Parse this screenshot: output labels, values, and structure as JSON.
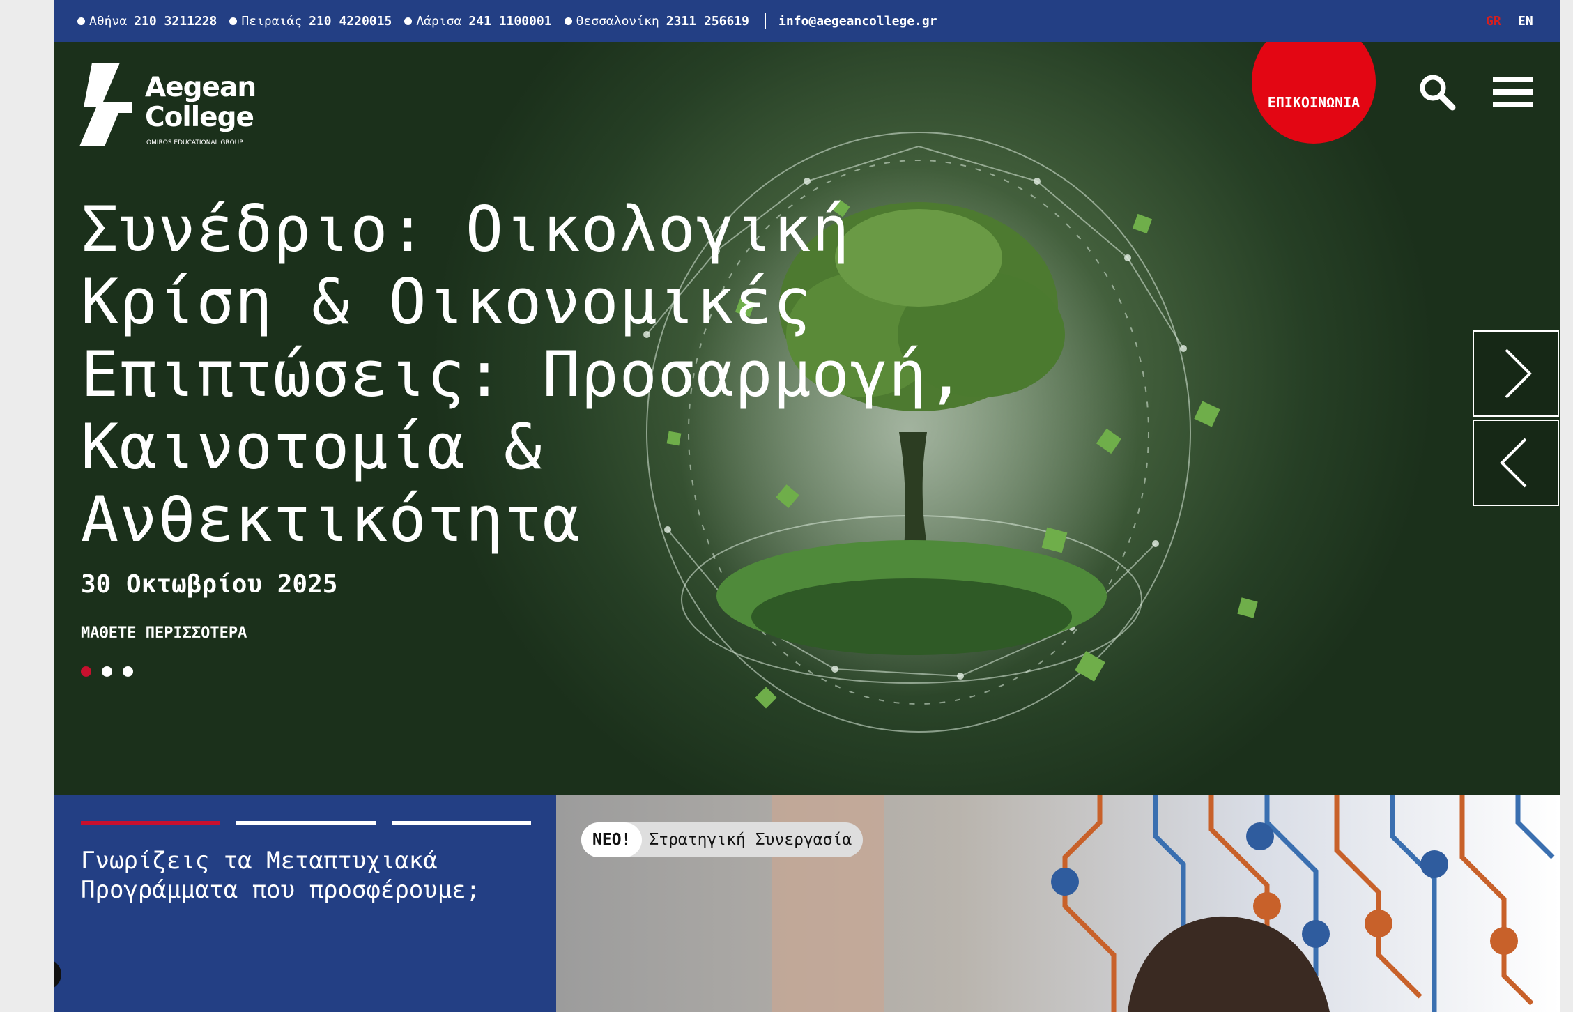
{
  "topbar": {
    "contacts": [
      {
        "city": "Αθήνα",
        "phone": "210 3211228"
      },
      {
        "city": "Πειραιάς",
        "phone": "210 4220015"
      },
      {
        "city": "Λάρισα",
        "phone": "241 1100001"
      },
      {
        "city": "Θεσσαλονίκη",
        "phone": "2311 256619"
      }
    ],
    "email": "info@aegeancollege.gr",
    "lang_gr": "GR",
    "lang_en": "EN"
  },
  "header": {
    "logo_line1": "Aegean",
    "logo_line2": "College",
    "logo_sub": "OMIROS EDUCATIONAL GROUP",
    "contact_button": "ΕΠΙΚΟΙΝΩΝΙΑ",
    "icons": [
      "search-icon",
      "hamburger-menu-icon"
    ]
  },
  "hero": {
    "title": "Συνέδριο: Οικολογική Κρίση & Οικονομικές Επιπτώσεις: Προσαρμογή, Καινοτομία & Ανθεκτικότητα",
    "date": "30 Οκτωβρίου 2025",
    "cta": "ΜΑΘΕΤΕ ΠΕΡΙΣΣΟΤΕΡΑ",
    "slide_count": 3,
    "active_slide": 1
  },
  "programs_panel": {
    "title": "Γνωρίζεις τα Μεταπτυχιακά Προγράμματα που προσφέρουμε;",
    "progress_count": 3,
    "active": 1
  },
  "partnership_panel": {
    "badge_new": "ΝΕΟ!",
    "badge_text": "Στρατηγική Συνεργασία"
  },
  "colors": {
    "brand_blue": "#233f84",
    "accent_red": "#e30613",
    "hero_green": "#2f4a2c"
  }
}
